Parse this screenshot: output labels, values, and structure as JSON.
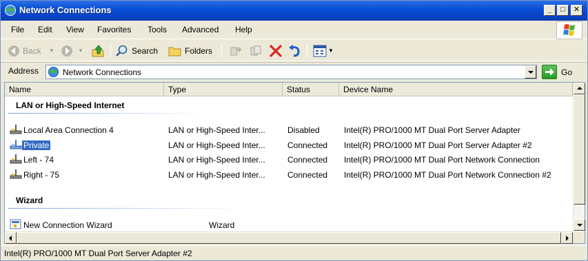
{
  "window": {
    "title": "Network Connections"
  },
  "caption_buttons": {
    "minimize": "_",
    "maximize": "□",
    "close": "✕"
  },
  "menubar": {
    "items": [
      {
        "label": "File",
        "mnemonic": "F",
        "rest": "ile"
      },
      {
        "label": "Edit",
        "mnemonic": "E",
        "rest": "dit"
      },
      {
        "label": "View",
        "mnemonic": "V",
        "rest": "iew"
      },
      {
        "label": "Favorites",
        "mnemonic": "a",
        "prefix": "F",
        "rest": "vorites"
      },
      {
        "label": "Tools",
        "mnemonic": "T",
        "rest": "ools"
      },
      {
        "label": "Advanced",
        "mnemonic": "n",
        "prefix": "Adva",
        "rest": "ced"
      },
      {
        "label": "Help",
        "mnemonic": "H",
        "rest": "elp"
      }
    ]
  },
  "toolbar": {
    "back_label": "Back",
    "search_label": "Search",
    "folders_label": "Folders"
  },
  "addressbar": {
    "label": "Address",
    "value": "Network Connections",
    "go_label": "Go"
  },
  "columns": [
    {
      "label": "Name"
    },
    {
      "label": "Type"
    },
    {
      "label": "Status"
    },
    {
      "label": "Device Name"
    }
  ],
  "groups": [
    {
      "title": "LAN or High-Speed Internet",
      "rows": [
        {
          "name": "Local Area Connection 4",
          "type": "LAN or High-Speed Inter...",
          "status": "Disabled",
          "device": "Intel(R) PRO/1000 MT Dual Port Server Adapter",
          "selected": false
        },
        {
          "name": "Private",
          "type": "LAN or High-Speed Inter...",
          "status": "Connected",
          "device": "Intel(R) PRO/1000 MT Dual Port Server Adapter #2",
          "selected": true
        },
        {
          "name": "Left - 74",
          "type": "LAN or High-Speed Inter...",
          "status": "Connected",
          "device": "Intel(R) PRO/1000 MT Dual Port Network Connection",
          "selected": false
        },
        {
          "name": "Right - 75",
          "type": "LAN or High-Speed Inter...",
          "status": "Connected",
          "device": "Intel(R) PRO/1000 MT Dual Port Network Connection #2",
          "selected": false
        }
      ]
    },
    {
      "title": "Wizard",
      "rows": [
        {
          "name": "New Connection Wizard",
          "type": "Wizard",
          "status": "",
          "device": "",
          "selected": false
        }
      ]
    }
  ],
  "statusbar": {
    "text": "Intel(R) PRO/1000 MT Dual Port Server Adapter #2"
  },
  "colors": {
    "titlebar": "#0a4fd6",
    "selection": "#316ac5",
    "chrome": "#ece9d8"
  }
}
